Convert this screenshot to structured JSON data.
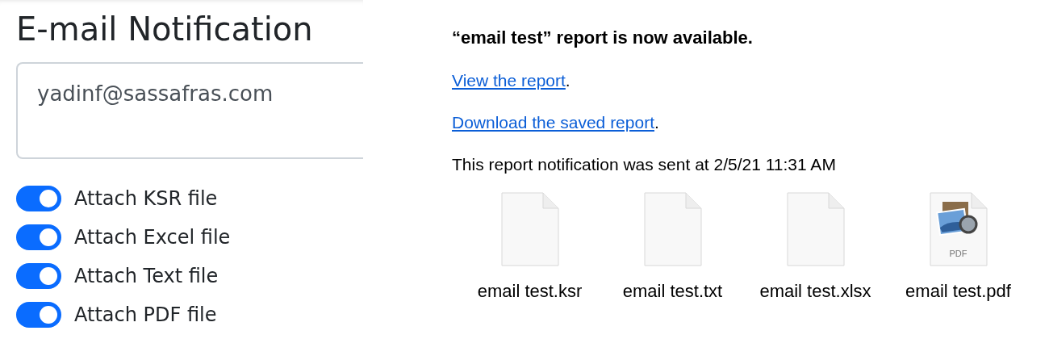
{
  "settings": {
    "title": "E-mail Notification",
    "recipients": {
      "value": "yadinf@sassafras.com"
    },
    "toggles": [
      {
        "label": "Attach KSR file",
        "on": true
      },
      {
        "label": "Attach Excel file",
        "on": true
      },
      {
        "label": "Attach Text file",
        "on": true
      },
      {
        "label": "Attach PDF file",
        "on": true
      }
    ]
  },
  "email": {
    "heading": "“email test” report is now available.",
    "links": [
      {
        "text": "View the report",
        "after": "."
      },
      {
        "text": "Download the saved report",
        "after": "."
      }
    ],
    "sent_note": "This report notification was sent at 2/5/21 11:31 AM",
    "attachments": [
      {
        "kind": "blank",
        "name": "email test.ksr"
      },
      {
        "kind": "blank",
        "name": "email test.txt"
      },
      {
        "kind": "blank",
        "name": "email test.xlsx"
      },
      {
        "kind": "pdf",
        "badge": "PDF",
        "name": "email test.pdf"
      }
    ]
  }
}
